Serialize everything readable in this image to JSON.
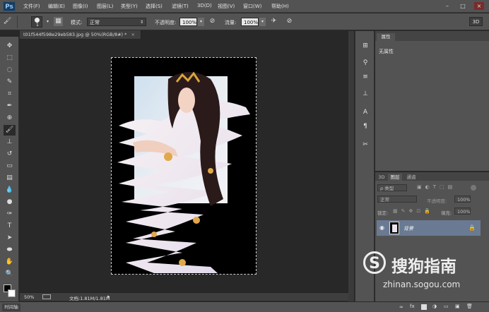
{
  "app": {
    "logo": "Ps"
  },
  "menu": [
    "文件(F)",
    "编辑(E)",
    "图像(I)",
    "图层(L)",
    "类型(Y)",
    "选择(S)",
    "滤镜(T)",
    "3D(D)",
    "视图(V)",
    "窗口(W)",
    "帮助(H)"
  ],
  "window_buttons": [
    "–",
    "□",
    "×"
  ],
  "options": {
    "mode_label": "模式:",
    "mode_value": "正常",
    "opacity_label": "不透明度:",
    "opacity_value": "100%",
    "flow_label": "流量:",
    "flow_value": "100%",
    "brush_size": "1",
    "view_3d": "3D"
  },
  "document": {
    "tab_title": "t01f544f598e29eb583.jpg @ 50%(RGB/8#) *",
    "close": "×"
  },
  "status": {
    "zoom": "50%",
    "doc_info": "文档:1.81M/1.81M"
  },
  "timeline": {
    "label": "时间轴"
  },
  "properties": {
    "tab": "属性",
    "content": "无属性"
  },
  "layers": {
    "tabs": [
      "3D",
      "图层",
      "通道"
    ],
    "filter": "类型",
    "blend": "正常",
    "opacity_label": "不透明度:",
    "opacity_value": "100%",
    "lock_label": "锁定:",
    "fill_label": "填充:",
    "fill_value": "100%",
    "layer_name": "背景"
  },
  "watermark": {
    "brand": "搜狗指南",
    "url": "zhinan.sogou.com"
  },
  "colors": {
    "chrome": "#535353",
    "panel": "#535353",
    "canvas_bg": "#282828",
    "selected_layer": "#6a7a93",
    "watermark": "#ffffff"
  }
}
